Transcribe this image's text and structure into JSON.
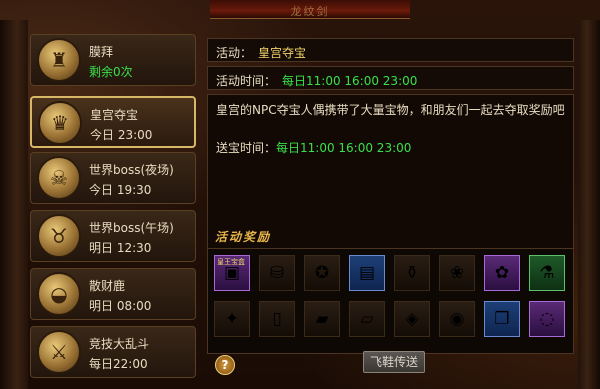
{
  "header": {
    "title": "龙纹剑"
  },
  "events": [
    {
      "name": "膜拜",
      "time": "剩余0次",
      "time_color": "green",
      "icon": "warrior-statue-icon"
    },
    {
      "name": "皇宫夺宝",
      "time": "今日 23:00",
      "time_color": "normal",
      "icon": "treasure-bag-icon",
      "active": true
    },
    {
      "name": "世界boss(夜场)",
      "time": "今日 19:30",
      "time_color": "normal",
      "icon": "demon-head-icon"
    },
    {
      "name": "世界boss(午场)",
      "time": "明日 12:30",
      "time_color": "normal",
      "icon": "horned-beast-icon"
    },
    {
      "name": "散财鹿",
      "time": "明日 08:00",
      "time_color": "normal",
      "icon": "gold-ingot-icon"
    },
    {
      "name": "竞技大乱斗",
      "time": "每日22:00",
      "time_color": "normal",
      "icon": "crossed-swords-icon"
    }
  ],
  "detail": {
    "activity_label": "活动：",
    "activity_value": "皇宫夺宝",
    "time_label": "活动时间：",
    "time_value": "每日11:00 16:00 23:00",
    "description": "皇宫的NPC夺宝人偶携带了大量宝物，和朋友们一起去夺取奖励吧",
    "send_label": "送宝时间：",
    "send_value": "每日11:00 16:00 23:00"
  },
  "rewards": {
    "title": "活动奖励",
    "items": [
      {
        "icon": "chest-icon",
        "color": "purple",
        "tag": "皇王宝盒"
      },
      {
        "icon": "gold-coins-icon",
        "color": "normal"
      },
      {
        "icon": "exp-badge-icon",
        "color": "normal"
      },
      {
        "icon": "skill-book-icon",
        "color": "blue"
      },
      {
        "icon": "potion-bottle-icon",
        "color": "normal"
      },
      {
        "icon": "rose-bouquet-icon",
        "color": "normal"
      },
      {
        "icon": "pouch-icon",
        "color": "purple"
      },
      {
        "icon": "green-potion-icon",
        "color": "green"
      },
      {
        "icon": "crystal-shard-icon",
        "color": "normal"
      },
      {
        "icon": "red-envelope-icon",
        "color": "normal"
      },
      {
        "icon": "gold-bar-icon",
        "color": "normal"
      },
      {
        "icon": "gold-bars-icon",
        "color": "normal"
      },
      {
        "icon": "gift-box-icon",
        "color": "normal"
      },
      {
        "icon": "red-bag-icon",
        "color": "normal"
      },
      {
        "icon": "red-gift-icon",
        "color": "blue"
      },
      {
        "icon": "purple-ring-icon",
        "color": "purple"
      }
    ]
  },
  "footer": {
    "help": "?",
    "teleport_label": "飞鞋传送"
  }
}
